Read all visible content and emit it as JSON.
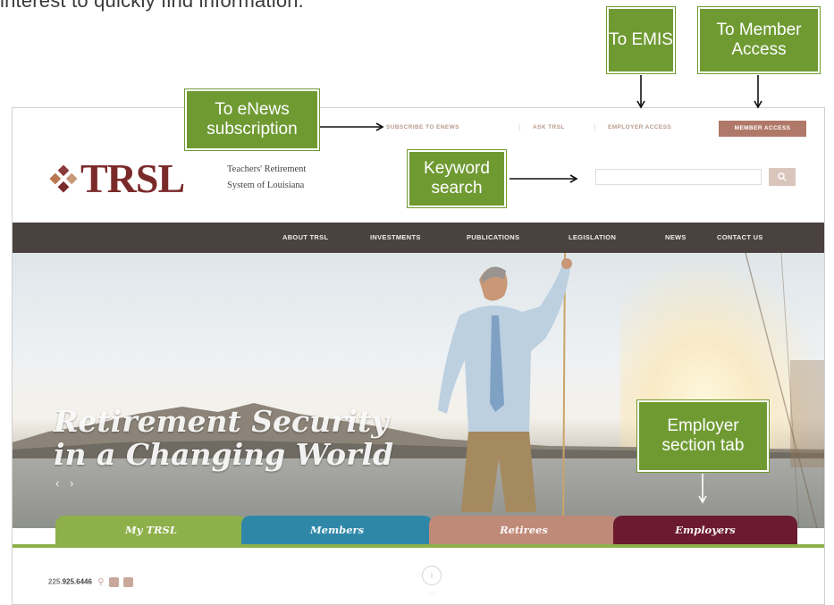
{
  "intro_text": "interest to quickly find information.",
  "annotations": {
    "enews": "To eNews subscription",
    "emis": "To EMIS",
    "member_access": "To Member Access",
    "keyword": "Keyword search",
    "employer_tab": "Employer section tab"
  },
  "utility_nav": {
    "subscribe": "SUBSCRIBE TO ENEWS",
    "ask": "ASK TRSL",
    "employer": "EMPLOYER ACCESS",
    "member": "MEMBER ACCESS"
  },
  "logo": {
    "wordmark": "TRSL",
    "line1": "Teachers' Retirement",
    "line2": "System of Louisiana"
  },
  "search": {
    "placeholder": ""
  },
  "main_nav": [
    "ABOUT TRSL",
    "INVESTMENTS",
    "PUBLICATIONS",
    "LEGISLATION",
    "NEWS",
    "CONTACT US"
  ],
  "hero": {
    "line1": "Retirement Security",
    "line2": "in a Changing World",
    "slider_controls": "‹ ›"
  },
  "tabs": [
    {
      "label": "My TRSL",
      "color": "#8eb04a"
    },
    {
      "label": "Members",
      "color": "#2f87a8"
    },
    {
      "label": "Retirees",
      "color": "#c08a78"
    },
    {
      "label": "Employers",
      "color": "#6b1a30"
    }
  ],
  "footer": {
    "phone_prefix": "225.",
    "phone_main": "925.6446"
  },
  "colors": {
    "callout_green": "#6f9a32",
    "nav_dark": "#4a423f",
    "brand_maroon": "#7b2a2a",
    "member_button": "#b07868"
  }
}
